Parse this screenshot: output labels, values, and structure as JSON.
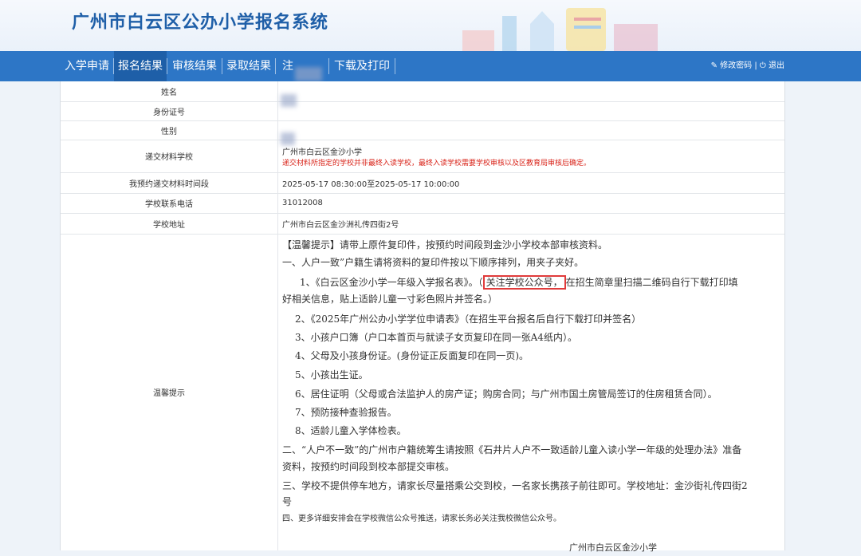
{
  "header": {
    "title": "广州市白云区公办小学报名系统"
  },
  "nav": {
    "items": [
      "入学申请",
      "报名结果",
      "审核结果",
      "录取结果",
      "注",
      "下载及打印"
    ],
    "active_index": 1,
    "right_edit": "修改密码",
    "right_sep": "|",
    "right_logout": "退出"
  },
  "rows": [
    {
      "label": "姓名",
      "value": ""
    },
    {
      "label": "身份证号",
      "value": ""
    },
    {
      "label": "性别",
      "value": ""
    },
    {
      "label": "递交材料学校",
      "value": "广州市白云区金沙小学",
      "note": "递交材料所指定的学校并非最终入读学校，最终入读学校需要学校审核以及区教育局审核后确定。"
    },
    {
      "label": "我预约递交材料时间段",
      "value": "2025-05-17 08:30:00至2025-05-17 10:00:00"
    },
    {
      "label": "学校联系电话",
      "value": "31012008"
    },
    {
      "label": "学校地址",
      "value": "广州市白云区金沙洲礼传四街2号"
    }
  ],
  "notice": {
    "label": "温馨提示",
    "line1": "【温馨提示】请带上原件复印件，按预约时间段到金沙小学校本部审核资料。",
    "line2": "一、人户一致”户籍生请将资料的复印件按以下顺序排列，用夹子夹好。",
    "item1_a": "1、《白云区金沙小学一年级入学报名表》。（",
    "item1_highlight": "关注学校公众号，",
    "item1_b": "在招生简章里扫描二维码自行下载打印填",
    "item1_c": "好相关信息，贴上适龄儿童一寸彩色照片并签名。）",
    "item2": "2、《2025年广州公办小学学位申请表》（在招生平台报名后自行下载打印并签名）",
    "item3": "3、小孩户口簿（户口本首页与就读子女页复印在同一张A4纸内）。",
    "item4": "4、父母及小孩身份证。(身份证正反面复印在同一页)。",
    "item5": "5、小孩出生证。",
    "item6": "6、居住证明（父母或合法监护人的房产证；购房合同；与广州市国土房管局签订的住房租赁合同）。",
    "item7": "7、预防接种查验报告。",
    "item8": "8、适龄儿童入学体检表。",
    "sec2_a": "二、“人户不一致”的广州市户籍统筹生请按照《石井片人户不一致适龄儿童入读小学一年级的处理办法》准备",
    "sec2_b": "资料，按预约时间段到校本部提交审核。",
    "sec3_a": "三、学校不提供停车地方，请家长尽量搭乘公交到校，一名家长携孩子前往即可。学校地址：金沙街礼传四街2",
    "sec3_b": "号",
    "sec4": "四、更多详细安排会在学校微信公众号推送，请家长务必关注我校微信公众号。",
    "footer": "广州市白云区金沙小学"
  }
}
